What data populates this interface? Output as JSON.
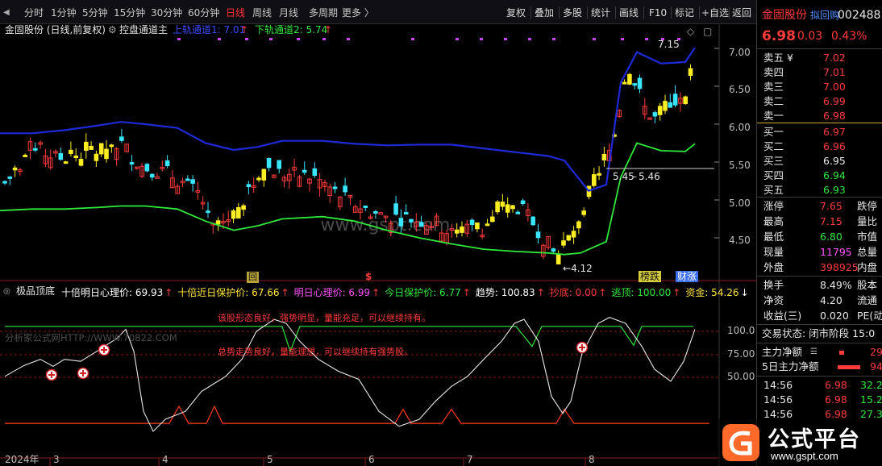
{
  "toolbar": {
    "periods": [
      "分时",
      "1分钟",
      "5分钟",
      "15分钟",
      "30分钟",
      "60分钟",
      "日线",
      "周线",
      "月线",
      "多周期",
      "更多 〉"
    ],
    "active_period": "日线",
    "buttons": [
      "复权",
      "叠加",
      "多股",
      "统计",
      "画线",
      "F10",
      "标记",
      "+自选",
      "返回"
    ]
  },
  "main_header": {
    "stock": "金固股份 (日线,前复权)",
    "indicator": "控盘通道主",
    "upper_label": "上轨通道1: 7.01",
    "lower_label": "下轨通道2: 5.74"
  },
  "price_axis": [
    "7.00",
    "6.50",
    "6.00",
    "5.50",
    "5.00",
    "4.50"
  ],
  "annotations": {
    "high": "7.15",
    "low": "4.12",
    "mid_left": "5.45",
    "mid_right": "5.46",
    "sig_box": "回",
    "sig_dollar": "$",
    "tag_bangdie": "榜跌",
    "tag_caizhang": "财涨"
  },
  "sub_header": {
    "name": "极品顶底",
    "items": [
      {
        "text": "十倍明日心理价: 69.93",
        "color": "#ffffff"
      },
      {
        "text": "十倍近日保护价: 67.66",
        "color": "#ffe23a"
      },
      {
        "text": "明日心理价: 6.99",
        "color": "#ff52ff"
      },
      {
        "text": "今日保护价: 6.77",
        "color": "#2ee83a"
      },
      {
        "text": "趋势: 100.83",
        "color": "#ffffff"
      },
      {
        "text": "抄底: 0.00",
        "color": "#ff3b3b"
      },
      {
        "text": "逃顶: 100.00",
        "color": "#2ee83a"
      },
      {
        "text": "资金: 54.26",
        "color": "#ffe23a"
      }
    ]
  },
  "sub_axis": [
    "100.0",
    "75.00",
    "50.00"
  ],
  "sub_texts": {
    "line1": "该股形态良好，强势明显，量能充足，可以继续持有。",
    "line2": "总势走势良好，量能理想，可以继续持有强势股。",
    "watermark": "分析家公式网HTTP://WWW.70822.COM"
  },
  "date_axis": [
    "2024年",
    "3",
    "4",
    "5",
    "6",
    "7",
    "8"
  ],
  "site_watermark": "www.gspt.com",
  "panel": {
    "name": "金固股份",
    "tag": "拟回购",
    "code": "002488",
    "price": "6.98",
    "change": "0.03",
    "pct": "0.43%",
    "asks": [
      {
        "label": "卖五 ¥",
        "price": "7.02"
      },
      {
        "label": "卖四",
        "price": "7.01"
      },
      {
        "label": "卖三",
        "price": "7.00"
      },
      {
        "label": "卖二",
        "price": "6.99"
      },
      {
        "label": "卖一",
        "price": "6.98"
      }
    ],
    "bids": [
      {
        "label": "买一",
        "price": "6.97"
      },
      {
        "label": "买二",
        "price": "6.96"
      },
      {
        "label": "买三",
        "price": "6.95"
      },
      {
        "label": "买四",
        "price": "6.94"
      },
      {
        "label": "买五",
        "price": "6.93"
      }
    ],
    "stats": [
      {
        "label": "涨停",
        "value": "7.65",
        "label2": "跌停",
        "color": "#ff3b3b"
      },
      {
        "label": "最高",
        "value": "7.15",
        "label2": "量比",
        "color": "#ff3b3b"
      },
      {
        "label": "最低",
        "value": "6.80",
        "label2": "市值",
        "color": "#2ee83a"
      },
      {
        "label": "现量",
        "value": "11795",
        "label2": "总量",
        "color": "#ff52ff"
      },
      {
        "label": "外盘",
        "value": "398925",
        "label2": "内盘",
        "color": "#ff3b3b"
      }
    ],
    "stats2": [
      {
        "label": "换手",
        "value": "8.49%",
        "label2": "股本"
      },
      {
        "label": "净资",
        "value": "4.20",
        "label2": "流通"
      },
      {
        "label": "收益(三)",
        "value": "0.020",
        "label2": "PE(动"
      }
    ],
    "status_label": "交易状态: 闭市阶段 15:0",
    "flows": [
      {
        "label": "主力净额",
        "value": "29"
      },
      {
        "label": "5日主力净额",
        "value": "94"
      }
    ],
    "ticks": [
      {
        "time": "14:56",
        "price": "6.98",
        "vol": "32.2"
      },
      {
        "time": "14:56",
        "price": "6.98",
        "vol": "15.2"
      },
      {
        "time": "14:56",
        "price": "6.98",
        "vol": "27.3"
      }
    ]
  },
  "logo": {
    "text": "公式平台",
    "url": "www.gspt.com"
  },
  "chart_data": {
    "type": "line",
    "title": "",
    "xlabel": "",
    "ylabel": "",
    "ylim": [
      4.0,
      7.3
    ],
    "x": [
      "2024年",
      "3",
      "4",
      "5",
      "6",
      "7",
      "8"
    ],
    "series": [
      {
        "name": "上轨通道1",
        "values": [
          5.88,
          5.92,
          6.03,
          5.75,
          5.66,
          5.73,
          5.63,
          5.5,
          5.12,
          6.92,
          7.01
        ]
      },
      {
        "name": "下轨通道2",
        "values": [
          4.86,
          4.9,
          4.92,
          4.72,
          4.78,
          4.62,
          4.35,
          4.28,
          4.45,
          5.7,
          5.74
        ]
      }
    ],
    "high": 7.15,
    "low": 4.12
  }
}
